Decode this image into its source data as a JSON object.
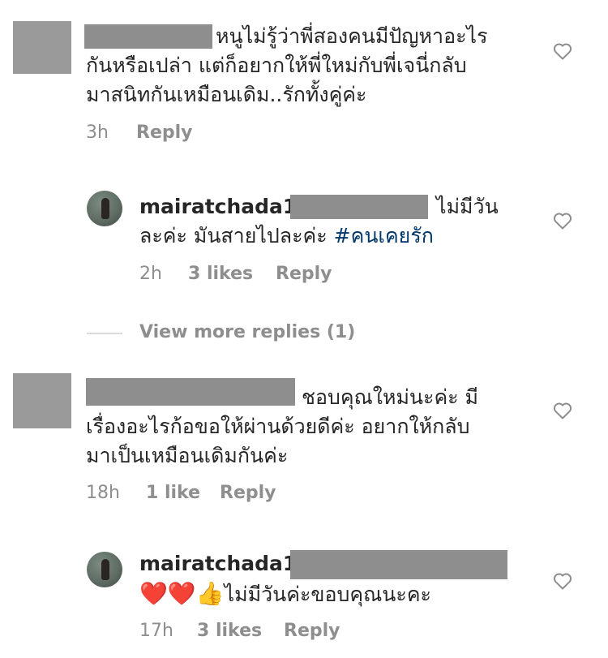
{
  "comments": [
    {
      "lines": [
        "หนูไม่รู้ว่าพี่สองคนมีปัญหาอะไร",
        "กันหรือเปล่า แต่ก็อยากให้พี่ใหม่กับพี่เจนี่กลับ",
        "มาสนิทกันเหมือนเดิม..รักทั้งคู่ค่ะ"
      ],
      "time": "3h",
      "reply": "Reply"
    },
    {
      "username": "mairatchada1",
      "line1": "ไม่มีวัน",
      "line2_text": "ละค่ะ มันสายไปละค่ะ ",
      "hashtag": "#คนเคยรัก",
      "time": "2h",
      "likes": "3 likes",
      "reply": "Reply"
    },
    {
      "view_more": "View more replies (1)"
    },
    {
      "lines": [
        "ชอบคุณใหม่นะค่ะ มี",
        "เรื่องอะไรก้อขอให้ผ่านด้วยดีค่ะ อยากให้กลับ",
        "มาเป็นเหมือนเดิมกันค่ะ"
      ],
      "time": "18h",
      "likes": "1 like",
      "reply": "Reply"
    },
    {
      "username": "mairatchada1",
      "emojis": "❤️❤️👍",
      "text": "ไม่มีวันค่ะขอบคุณนะคะ",
      "time": "17h",
      "likes": "3 likes",
      "reply": "Reply"
    }
  ],
  "icons": {
    "like": "heart-outline-icon"
  }
}
